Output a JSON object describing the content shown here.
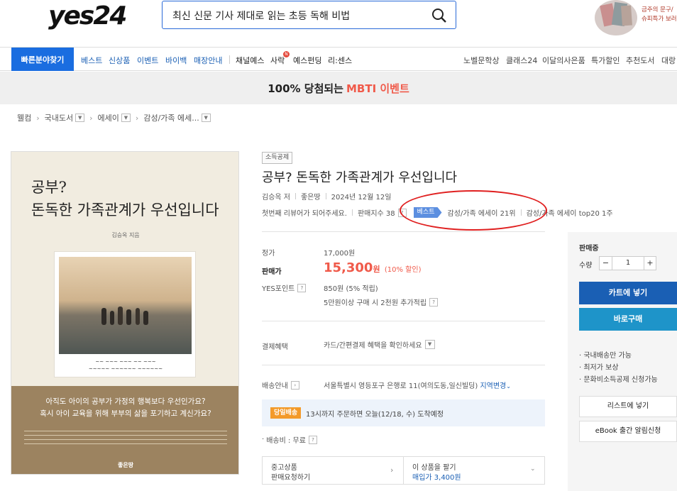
{
  "header": {
    "logo": "yes24",
    "search_value": "최신 신문 기사 제대로 읽는 초등 독해 비법",
    "promo_line1": "금주의 문구/",
    "promo_line2": "슈피특가 보러"
  },
  "nav": {
    "quick_find": "빠른분야찾기",
    "left_items": [
      "베스트",
      "신상품",
      "이벤트",
      "바이백",
      "매장안내"
    ],
    "mid_items": [
      "채널예스",
      "사락",
      "예스펀딩",
      "리:센스"
    ],
    "sarak_badge": "N",
    "right_items": [
      "노벨문학상",
      "클래스24",
      "이달의사은품",
      "특가할인",
      "추천도서",
      "대랑"
    ]
  },
  "banner": {
    "text": "100% 당첨되는",
    "highlight": "MBTI 이벤트"
  },
  "breadcrumb": {
    "home": "웰컴",
    "level1": "국내도서",
    "level2": "에세이",
    "level3": "감성/가족 에세..."
  },
  "cover": {
    "title_line1": "공부?",
    "title_line2": "돈독한 가족관계가 우선입니다",
    "author": "김승옥 지음",
    "quote_line1": "아직도 아이의 공부가 가정의 행복보다 우선인가요?",
    "quote_line2": "혹시 아이 교육을 위해 부부의 삶을 포기하고 계신가요?",
    "publisher": "좋은땅"
  },
  "product": {
    "tag": "소득공제",
    "title": "공부? 돈독한 가족관계가 우선입니다",
    "author": "김승옥 저",
    "publisher": "좋은땅",
    "date": "2024년 12월 12일",
    "review_prompt": "첫번째 리뷰어가 되어주세요.",
    "sales_index": "판매지수 38",
    "best_badge": "베스트",
    "rank1": "감성/가족 에세이 21위",
    "rank2": "감성/가족 에세이 top20 1주"
  },
  "price": {
    "orig_label": "정가",
    "orig_value": "17,000원",
    "sale_label": "판매가",
    "sale_value": "15,300",
    "sale_unit": "원",
    "discount": "(10% 할인)",
    "point_label": "YES포인트",
    "point_value": "850원 (5% 적립)",
    "point_extra": "5만원이상 구매 시 2천원 추가적립"
  },
  "payment": {
    "label": "결제혜택",
    "value": "카드/간편결제 혜택을 확인하세요"
  },
  "shipping": {
    "label": "배송안내",
    "address": "서울특별시 영등포구 은행로 11(여의도동,일신빌딩)",
    "change": "지역변경",
    "same_day_badge": "당일배송",
    "same_day_text": "13시까지 주문하면 오늘(12/18, 수) 도착예정",
    "fee": "배송비 : 무료"
  },
  "used": {
    "left_line1": "중고상품",
    "left_line2": "판매요청하기",
    "right_line1": "이 상품을 팔기",
    "right_line2": "매입가 3,400원"
  },
  "side": {
    "status": "판매중",
    "qty_label": "수량",
    "qty_value": "1",
    "cart": "카트에 넣기",
    "buy": "바로구매",
    "notes": [
      "· 국내배송만 가능",
      "· 최저가 보상",
      "· 문화비소득공제 신청가능"
    ],
    "wishlist": "리스트에 넣기",
    "ebook_alert": "eBook 출간 알림신청"
  }
}
